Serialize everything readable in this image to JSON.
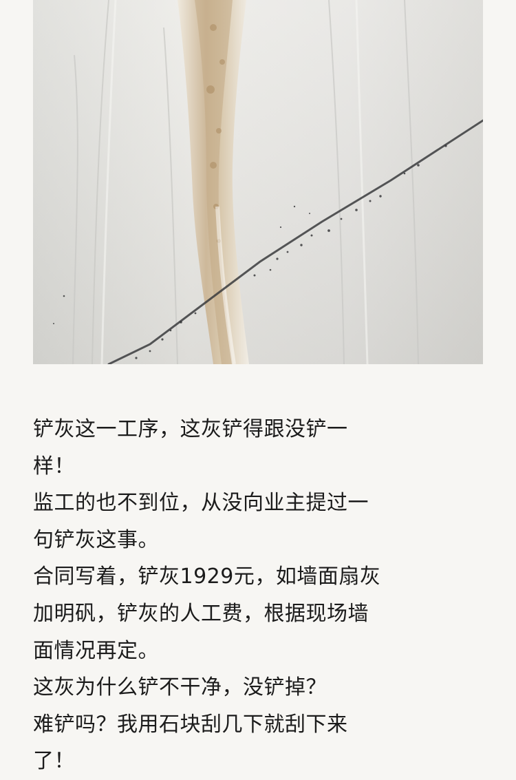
{
  "post": {
    "paragraphs": [
      "铲灰这一工序，这灰铲得跟没铲一",
      "样！",
      "监工的也不到位，从没向业主提过一",
      "句铲灰这事。",
      "合同写着，铲灰1929元，如墙面扇灰",
      "加明矾，铲灰的人工费，根据现场墙",
      "面情况再定。",
      "这灰为什么铲不干净，没铲掉？",
      "难铲吗？我用石块刮几下就刮下来",
      "了！"
    ]
  },
  "colors": {
    "page_background": "#f7f6f3",
    "text": "#1b1b1b"
  }
}
